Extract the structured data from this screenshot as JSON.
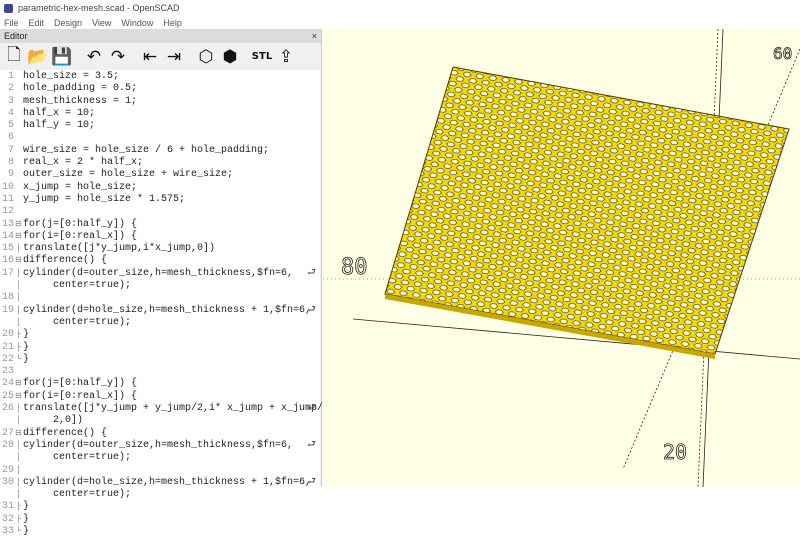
{
  "window": {
    "title": "parametric-hex-mesh.scad - OpenSCAD"
  },
  "menu": [
    "File",
    "Edit",
    "Design",
    "View",
    "Window",
    "Help"
  ],
  "editor": {
    "title": "Editor",
    "close": "×",
    "toolbar": [
      {
        "name": "new-file",
        "glyph": "🗋"
      },
      {
        "name": "open-file",
        "glyph": "📂"
      },
      {
        "name": "save-file",
        "glyph": "💾"
      },
      {
        "name": "undo",
        "glyph": "↶"
      },
      {
        "name": "redo",
        "glyph": "↷"
      },
      {
        "name": "unindent",
        "glyph": "⇤"
      },
      {
        "name": "indent",
        "glyph": "⇥"
      },
      {
        "name": "preview",
        "glyph": "⬡"
      },
      {
        "name": "render",
        "glyph": "⬢"
      },
      {
        "name": "export-stl",
        "glyph": "STL"
      },
      {
        "name": "send-to-print",
        "glyph": "⇪"
      }
    ],
    "lines": [
      {
        "n": "1",
        "t": "hole_size = 3.5;"
      },
      {
        "n": "2",
        "t": "hole_padding = 0.5;"
      },
      {
        "n": "3",
        "t": "mesh_thickness = 1;"
      },
      {
        "n": "4",
        "t": "half_x = 10;"
      },
      {
        "n": "5",
        "t": "half_y = 10;"
      },
      {
        "n": "6",
        "t": ""
      },
      {
        "n": "7",
        "t": "wire_size = hole_size / 6 + hole_padding;"
      },
      {
        "n": "8",
        "t": "real_x = 2 * half_x;"
      },
      {
        "n": "9",
        "t": "outer_size = hole_size + wire_size;"
      },
      {
        "n": "10",
        "t": "x_jump = hole_size;"
      },
      {
        "n": "11",
        "t": "y_jump = hole_size * 1.575;"
      },
      {
        "n": "12",
        "t": ""
      },
      {
        "n": "13",
        "f": "⊟",
        "t": "for(j=[0:half_y]) {"
      },
      {
        "n": "14",
        "f": "⊟",
        "t": "for(i=[0:real_x]) {"
      },
      {
        "n": "15",
        "f": "│",
        "t": "translate([j*y_jump,i*x_jump,0])"
      },
      {
        "n": "16",
        "f": "⊟",
        "t": "difference() {"
      },
      {
        "n": "17",
        "f": "│",
        "t": "cylinder(d=outer_size,h=mesh_thickness,$fn=6,",
        "w": "⮐"
      },
      {
        "n": "",
        "f": "│",
        "t": "     center=true);"
      },
      {
        "n": "18",
        "f": "│",
        "t": ""
      },
      {
        "n": "19",
        "f": "│",
        "t": "cylinder(d=hole_size,h=mesh_thickness + 1,$fn=6,",
        "w": "⮐"
      },
      {
        "n": "",
        "f": "│",
        "t": "     center=true);"
      },
      {
        "n": "20",
        "f": "├",
        "t": "}"
      },
      {
        "n": "21",
        "f": "├",
        "t": "}"
      },
      {
        "n": "22",
        "f": "└",
        "t": "}"
      },
      {
        "n": "23",
        "t": ""
      },
      {
        "n": "24",
        "f": "⊟",
        "t": "for(j=[0:half_y]) {"
      },
      {
        "n": "25",
        "f": "⊟",
        "t": "for(i=[0:real_x]) {"
      },
      {
        "n": "26",
        "f": "│",
        "t": "translate([j*y_jump + y_jump/2,i* x_jump + x_jump/",
        "w": "⮐"
      },
      {
        "n": "",
        "f": "│",
        "t": "     2,0])"
      },
      {
        "n": "27",
        "f": "⊟",
        "t": "difference() {"
      },
      {
        "n": "28",
        "f": "│",
        "t": "cylinder(d=outer_size,h=mesh_thickness,$fn=6,",
        "w": "⮐"
      },
      {
        "n": "",
        "f": "│",
        "t": "     center=true);"
      },
      {
        "n": "29",
        "f": "│",
        "t": ""
      },
      {
        "n": "30",
        "f": "│",
        "t": "cylinder(d=hole_size,h=mesh_thickness + 1,$fn=6,",
        "w": "⮐"
      },
      {
        "n": "",
        "f": "│",
        "t": "     center=true);"
      },
      {
        "n": "31",
        "f": "├",
        "t": "}"
      },
      {
        "n": "32",
        "f": "├",
        "t": "}"
      },
      {
        "n": "33",
        "f": "└",
        "t": "}"
      }
    ]
  },
  "viewport": {
    "background": "#ffffe5",
    "mesh_color": "#f5d800",
    "edge_color": "#3a3000"
  }
}
